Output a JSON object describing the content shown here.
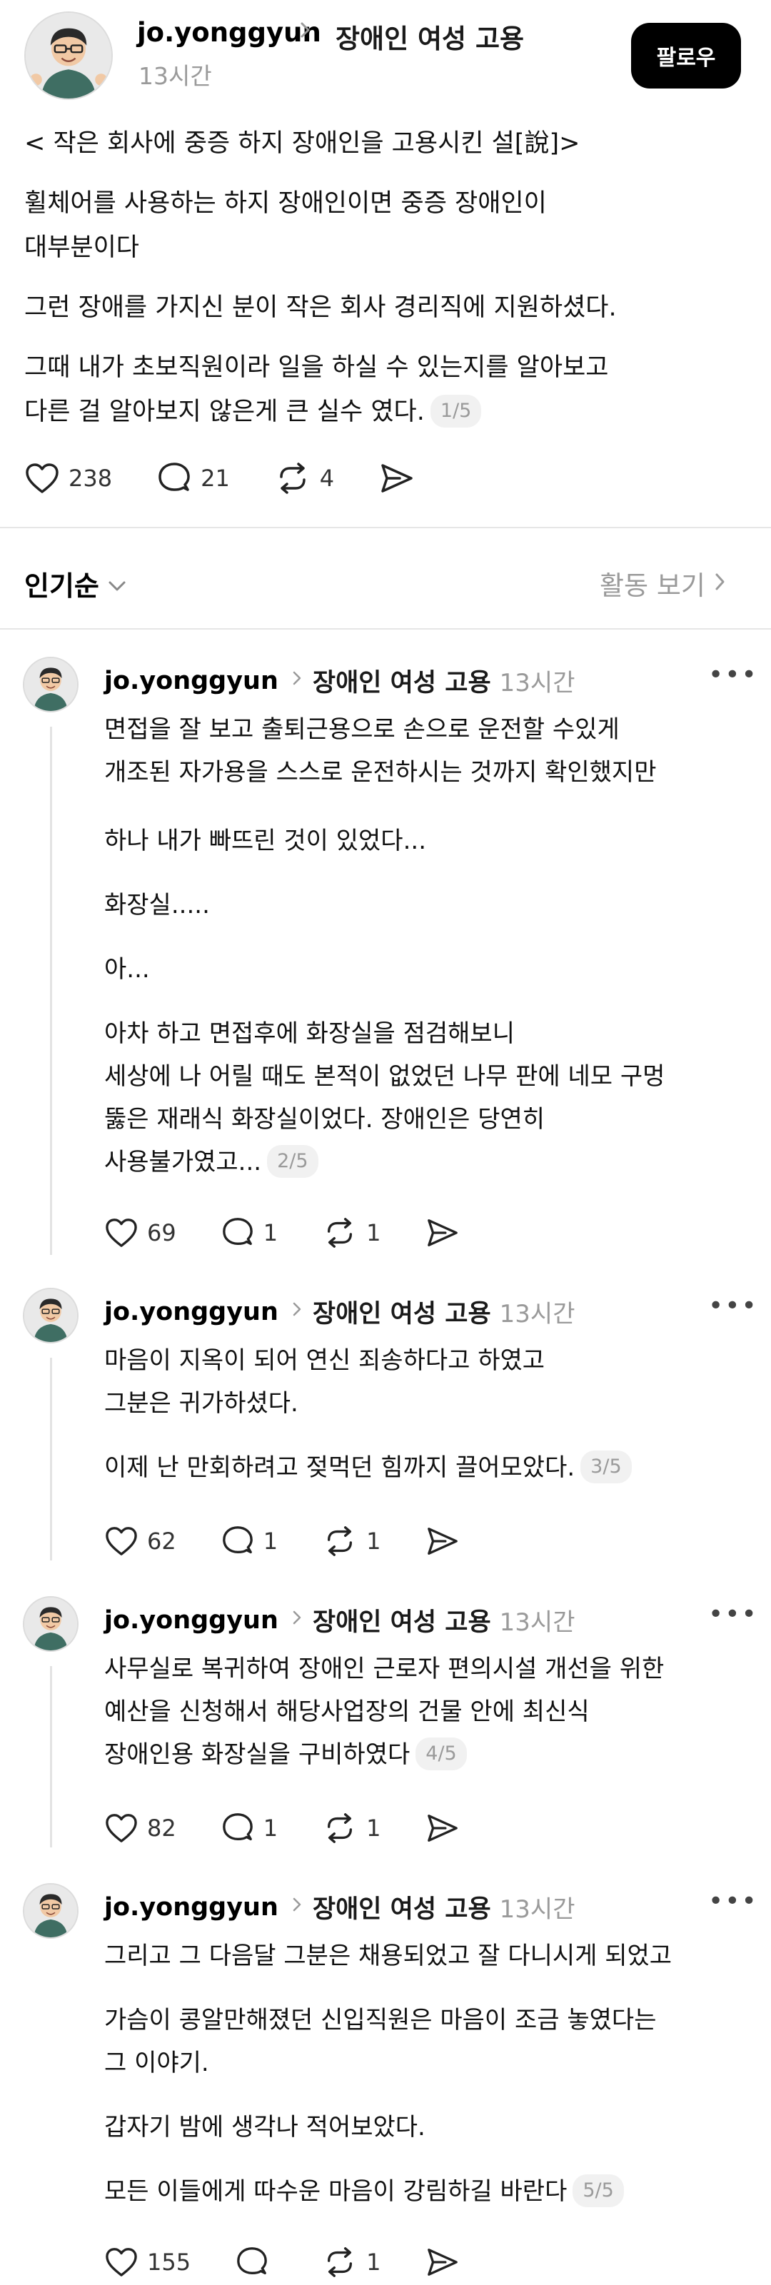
{
  "post": {
    "username": "jo.yonggyun",
    "topic": "장애인 여성 고용",
    "time": "13시간",
    "follow_label": "팔로우",
    "paragraphs": [
      [
        "< 작은 회사에 중증 하지 장애인을 고용시킨 설[說]>"
      ],
      [
        "휠체어를 사용하는 하지 장애인이면 중증 장애인이",
        "대부분이다"
      ],
      [
        "그런 장애를 가지신 분이 작은 회사 경리직에 지원하셨다."
      ],
      [
        "그때 내가 초보직원이라 일을 하실 수 있는지를 알아보고",
        "다른 걸 알아보지 않은게 큰 실수 였다."
      ]
    ],
    "page": "1/5",
    "likes": "238",
    "replies": "21",
    "reposts": "4"
  },
  "sort": {
    "label": "인기순",
    "activity_label": "활동 보기"
  },
  "replies": [
    {
      "username": "jo.yonggyun",
      "topic": "장애인 여성 고용",
      "time": "13시간",
      "paragraphs": [
        [
          "면접을 잘 보고 출퇴근용으로 손으로 운전할 수있게",
          "개조된 자가용을  스스로 운전하시는 것까지 확인했지만"
        ],
        [
          "하나 내가 빠뜨린 것이 있었다..."
        ],
        [
          "화장실....."
        ],
        [
          "아..."
        ],
        [
          "아차 하고 면접후에 화장실을 점검해보니",
          "세상에 나 어릴 때도 본적이 없었던 나무 판에 네모 구멍",
          "뚫은 재래식 화장실이었다.  장애인은 당연히",
          "사용불가였고..."
        ]
      ],
      "page": "2/5",
      "likes": "69",
      "replies": "1",
      "reposts": "1"
    },
    {
      "username": "jo.yonggyun",
      "topic": "장애인 여성 고용",
      "time": "13시간",
      "paragraphs": [
        [
          "마음이 지옥이 되어 연신 죄송하다고 하였고",
          "그분은 귀가하셨다."
        ],
        [
          "이제 난 만회하려고 젖먹던 힘까지 끌어모았다."
        ]
      ],
      "page": "3/5",
      "likes": "62",
      "replies": "1",
      "reposts": "1"
    },
    {
      "username": "jo.yonggyun",
      "topic": "장애인 여성 고용",
      "time": "13시간",
      "paragraphs": [
        [
          "사무실로 복귀하여 장애인 근로자 편의시설 개선을 위한",
          "예산을 신청해서 해당사업장의 건물 안에 최신식",
          "장애인용 화장실을 구비하였다"
        ]
      ],
      "page": "4/5",
      "likes": "82",
      "replies": "1",
      "reposts": "1"
    },
    {
      "username": "jo.yonggyun",
      "topic": "장애인 여성 고용",
      "time": "13시간",
      "paragraphs": [
        [
          "그리고 그 다음달 그분은 채용되었고 잘 다니시게 되었고"
        ],
        [
          "가슴이 콩알만해졌던 신입직원은 마음이 조금 놓였다는",
          "그 이야기."
        ],
        [
          "갑자기 밤에 생각나 적어보았다."
        ],
        [
          "모든 이들에게 따수운 마음이 강림하길 바란다"
        ]
      ],
      "page": "5/5",
      "likes": "155",
      "replies": "",
      "reposts": "1"
    }
  ],
  "icons": {
    "avatar": "avatar-photo",
    "like": "heart-icon",
    "reply": "comment-bubble-icon",
    "repost": "repost-icon",
    "share": "share-send-icon",
    "more": "more-dots-icon",
    "chevron_down": "chevron-down-icon",
    "chevron_right": "chevron-right-icon"
  },
  "colors": {
    "text": "#111111",
    "muted": "#9a9a9a",
    "button_bg": "#000000",
    "divider": "#e6e6e6"
  }
}
